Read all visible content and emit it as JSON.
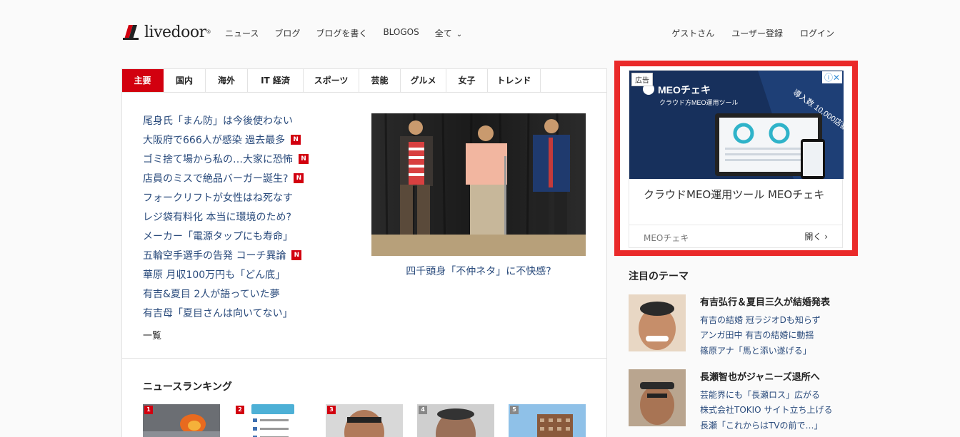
{
  "header": {
    "logo_text": "livedoor",
    "nav": [
      "ニュース",
      "ブログ",
      "ブログを書く",
      "BLOGOS",
      "全て"
    ],
    "user_nav": [
      "ゲストさん",
      "ユーザー登録",
      "ログイン"
    ]
  },
  "tabs": [
    "主要",
    "国内",
    "海外",
    "IT 経済",
    "スポーツ",
    "芸能",
    "グルメ",
    "女子",
    "トレンド"
  ],
  "headlines": [
    {
      "text": "尾身氏「まん防」は今後使わない",
      "new": false
    },
    {
      "text": "大阪府で666人が感染 過去最多",
      "new": true
    },
    {
      "text": "ゴミ捨て場から私の…大家に恐怖",
      "new": true
    },
    {
      "text": "店員のミスで絶品バーガー誕生?",
      "new": true
    },
    {
      "text": "フォークリフトが女性はね死なす",
      "new": false
    },
    {
      "text": "レジ袋有料化 本当に環境のため?",
      "new": false
    },
    {
      "text": "メーカー「電源タップにも寿命」",
      "new": false
    },
    {
      "text": "五輪空手選手の告発 コーチ異論",
      "new": true
    },
    {
      "text": "華原 月収100万円も「どん底」",
      "new": false
    },
    {
      "text": "有吉&夏目 2人が語っていた夢",
      "new": false
    },
    {
      "text": "有吉母「夏目さんは向いてない」",
      "new": false
    }
  ],
  "new_badge": "N",
  "more_label": "一覧",
  "feature_caption": "四千頭身「不仲ネタ」に不快感?",
  "ranking": {
    "title": "ニュースランキング",
    "numbers": [
      "1",
      "2",
      "3",
      "4",
      "5"
    ]
  },
  "ad": {
    "badge": "広告",
    "brand": "MEOチェキ",
    "tagline": "クラウド方MEO運用ツール",
    "banner_note": "導入数 10,000店舗",
    "headline": "クラウドMEO運用ツール MEOチェキ",
    "sponsor": "MEOチェキ",
    "open_label": "開く"
  },
  "themes": {
    "title": "注目のテーマ",
    "items": [
      {
        "head": "有吉弘行＆夏目三久が結婚発表",
        "links": [
          "有吉の結婚 冠ラジオDも知らず",
          "アンガ田中 有吉の結婚に動揺",
          "篠原アナ「馬と添い遂げる」"
        ]
      },
      {
        "head": "長瀬智也がジャニーズ退所へ",
        "links": [
          "芸能界にも「長瀬ロス」広がる",
          "株式会社TOKIO サイト立ち上げる",
          "長瀬「これからはTVの前で…」"
        ]
      }
    ]
  },
  "colors": {
    "accent": "#d2000f",
    "ad_border": "#ea2a2a",
    "link": "#2a4b7c"
  }
}
